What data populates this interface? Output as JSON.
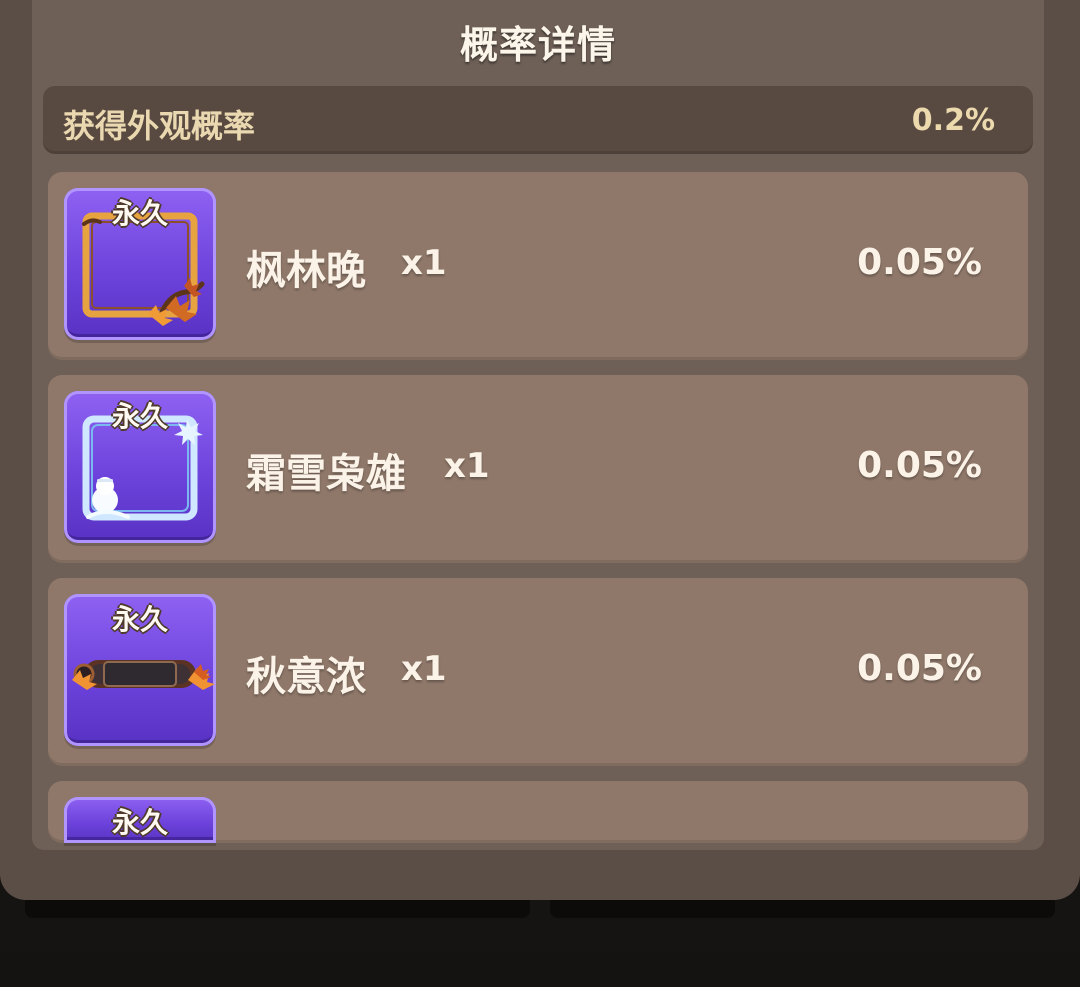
{
  "dialog": {
    "title": "概率详情",
    "summary": {
      "label": "获得外观概率",
      "value": "0.2%"
    }
  },
  "items": [
    {
      "badge": "永久",
      "name": "枫林晚",
      "qty": "x1",
      "rate": "0.05%",
      "icon": "maple-frame-icon"
    },
    {
      "badge": "永久",
      "name": "霜雪枭雄",
      "qty": "x1",
      "rate": "0.05%",
      "icon": "frost-frame-icon"
    },
    {
      "badge": "永久",
      "name": "秋意浓",
      "qty": "x1",
      "rate": "0.05%",
      "icon": "autumn-nameplate-icon"
    },
    {
      "badge": "永久"
    }
  ],
  "colors": {
    "panel": "#6e6057",
    "summary_bg": "#594a41",
    "row_bg": "#8f786a",
    "thumb_purple": "#6d43dc",
    "text_light": "#fbf3e8",
    "text_gold": "#ecd9ae"
  }
}
